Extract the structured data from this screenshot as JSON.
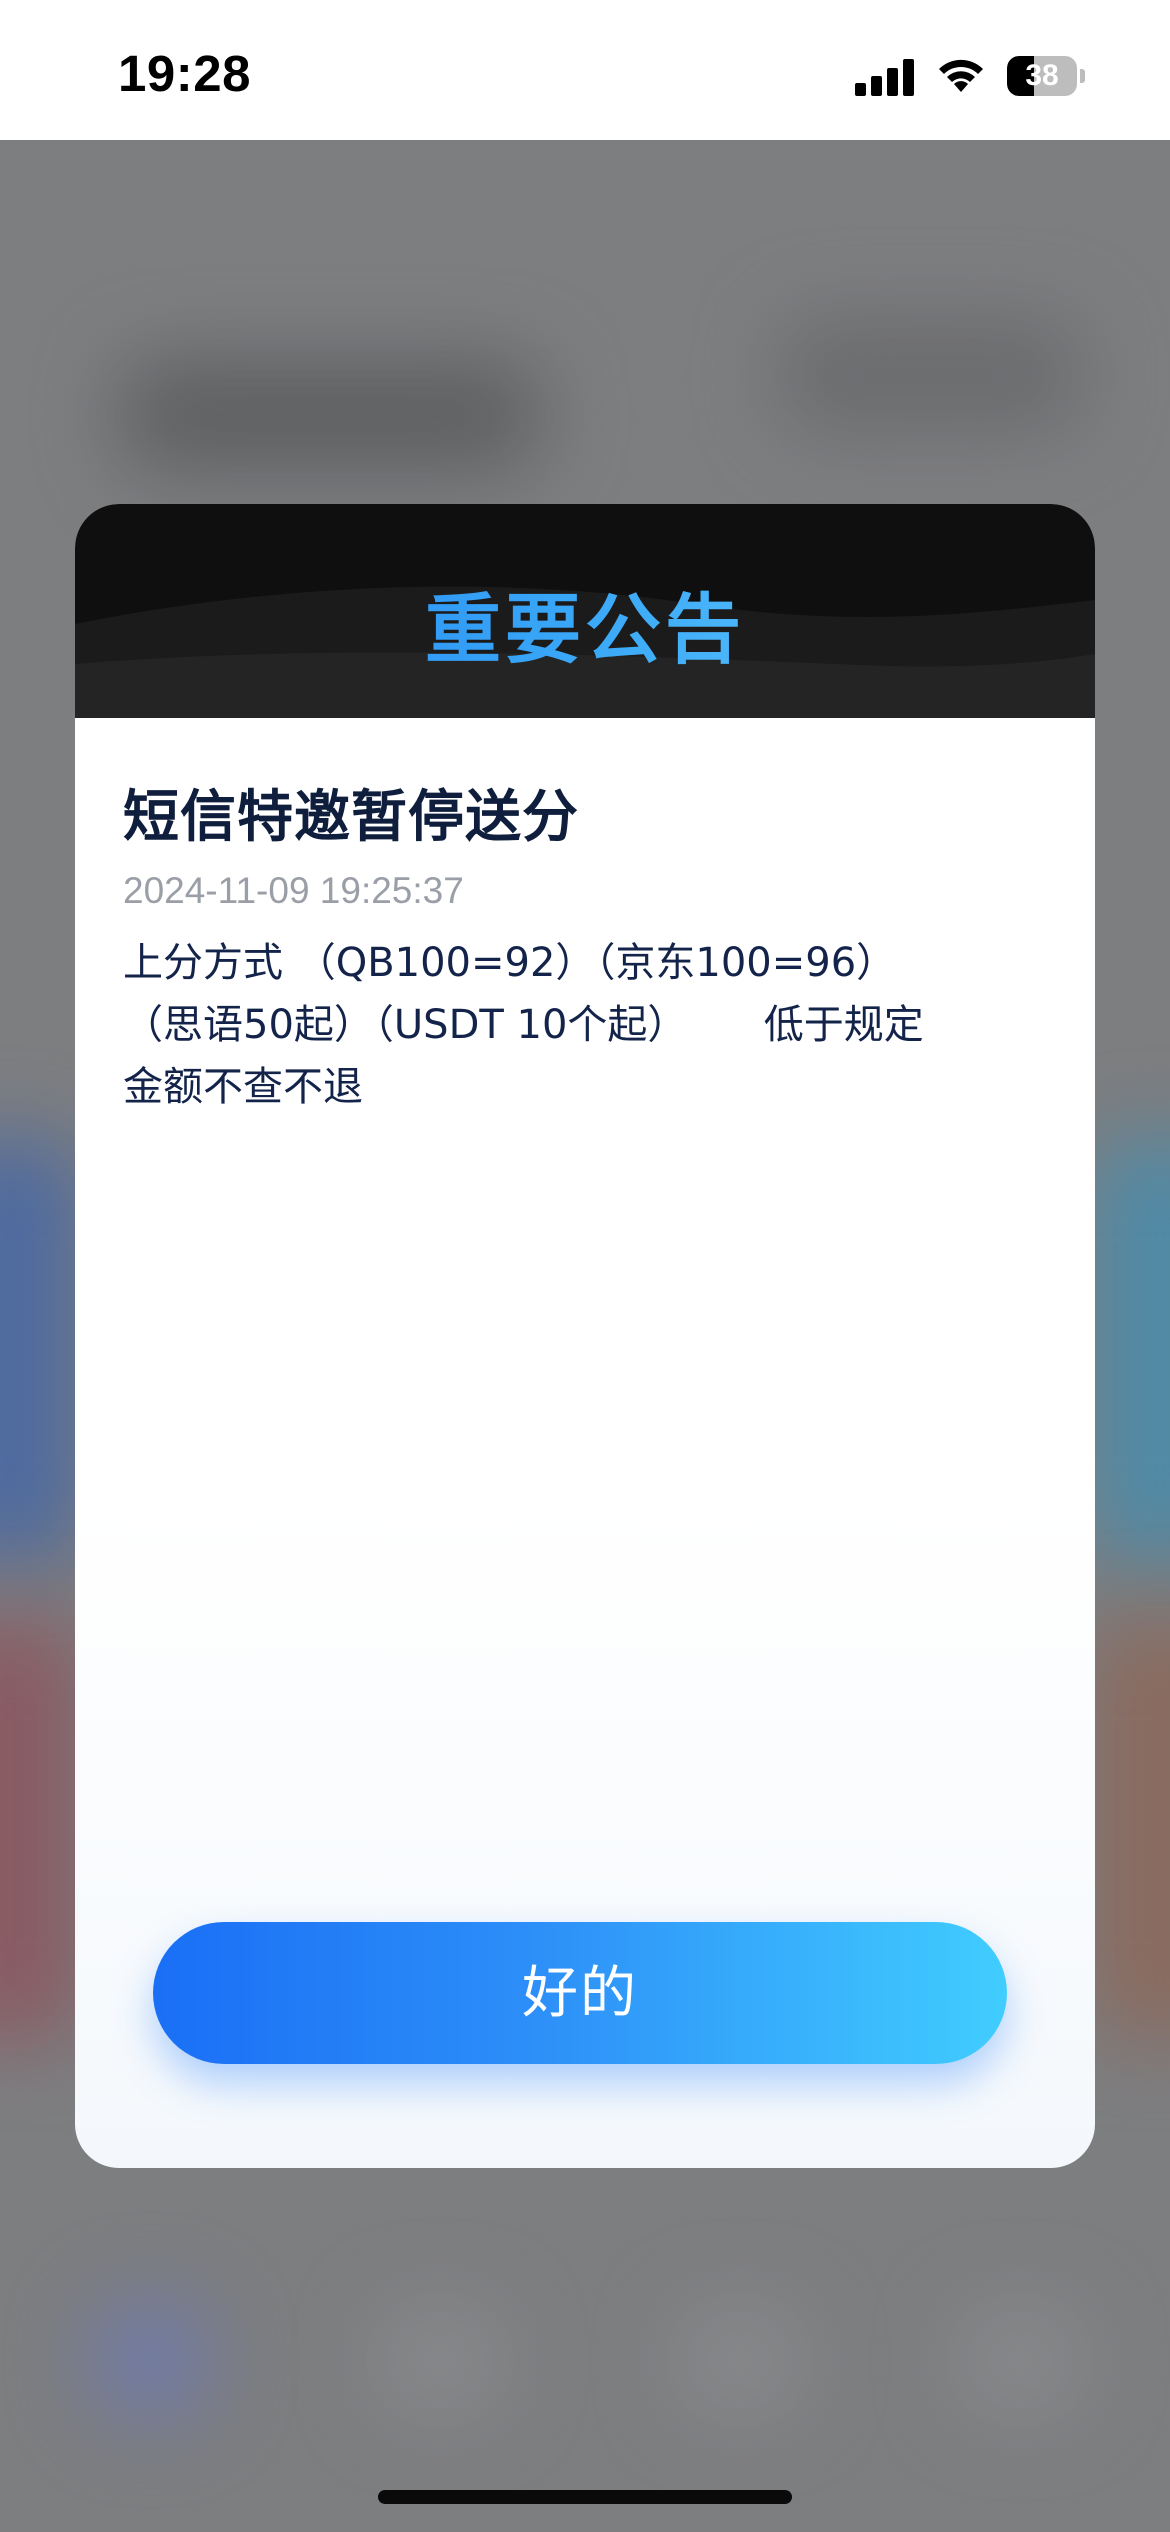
{
  "status_bar": {
    "time": "19:28",
    "battery_level": "38",
    "battery_fraction": 0.38
  },
  "modal": {
    "title": "重要公告",
    "notice_title": "短信特邀暂停送分",
    "date": "2024-11-09 19:25:37",
    "body": "上分方式 （QB100=92）（京东100=96）\n（思语50起）（USDT 10个起）      低于规定\n金额不查不退",
    "ok_label": "好的"
  },
  "colors": {
    "title_gradient_start": "#1f7ff2",
    "title_gradient_end": "#6fd3ff",
    "button_gradient_start": "#1a6ff5",
    "button_gradient_end": "#41cdfe",
    "header_background": "#0f0f10",
    "overlay": "#7d7e80"
  },
  "icons": {
    "signal": "cellular-signal-icon",
    "wifi": "wifi-icon",
    "battery": "battery-icon"
  }
}
